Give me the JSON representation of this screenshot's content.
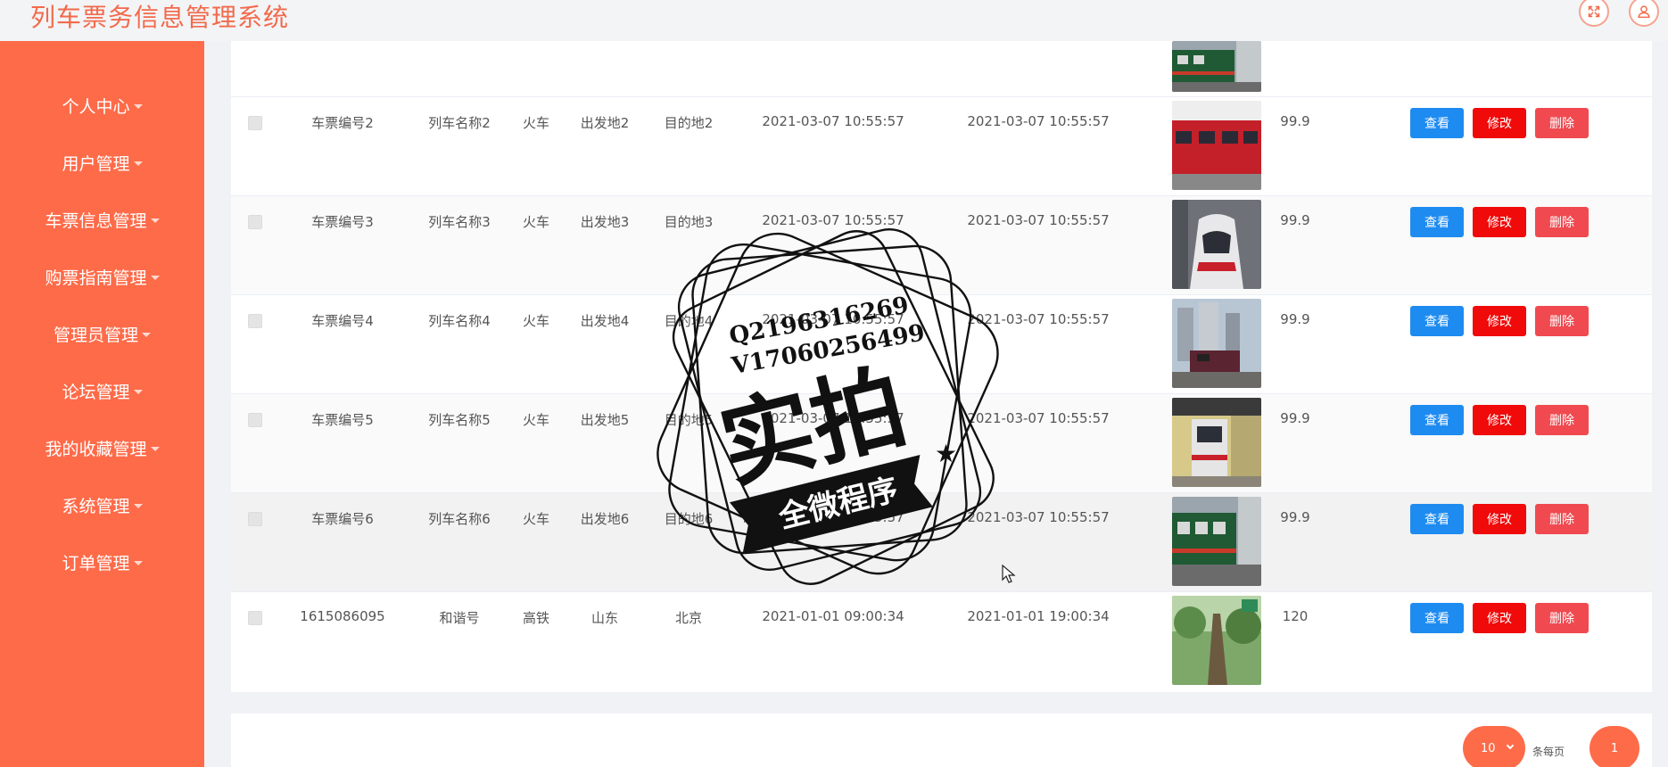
{
  "app": {
    "title": "列车票务信息管理系统"
  },
  "header": {
    "fullscreen_icon": "fullscreen-icon",
    "user_icon": "user-icon"
  },
  "sidebar": {
    "items": [
      {
        "label": "个人中心"
      },
      {
        "label": "用户管理"
      },
      {
        "label": "车票信息管理"
      },
      {
        "label": "购票指南管理"
      },
      {
        "label": "管理员管理"
      },
      {
        "label": "论坛管理"
      },
      {
        "label": "我的收藏管理"
      },
      {
        "label": "系统管理"
      },
      {
        "label": "订单管理"
      }
    ]
  },
  "table": {
    "rows": [
      {
        "ticket_no": "车票编号2",
        "train_name": "列车名称2",
        "type": "火车",
        "from": "出发地2",
        "to": "目的地2",
        "depart": "2021-03-07 10:55:57",
        "arrive": "2021-03-07 10:55:57",
        "price": "99.9",
        "image": "red-train-photo"
      },
      {
        "ticket_no": "车票编号3",
        "train_name": "列车名称3",
        "type": "火车",
        "from": "出发地3",
        "to": "目的地3",
        "depart": "2021-03-07 10:55:57",
        "arrive": "2021-03-07 10:55:57",
        "price": "99.9",
        "image": "subway-train-photo"
      },
      {
        "ticket_no": "车票编号4",
        "train_name": "列车名称4",
        "type": "火车",
        "from": "出发地4",
        "to": "目的地4",
        "depart": "2021-03-07 10:55:57",
        "arrive": "2021-03-07 10:55:57",
        "price": "99.9",
        "image": "city-train-photo"
      },
      {
        "ticket_no": "车票编号5",
        "train_name": "列车名称5",
        "type": "火车",
        "from": "出发地5",
        "to": "目的地5",
        "depart": "2021-03-07 10:55:57",
        "arrive": "2021-03-07 10:55:57",
        "price": "99.9",
        "image": "station-train-photo"
      },
      {
        "ticket_no": "车票编号6",
        "train_name": "列车名称6",
        "type": "火车",
        "from": "出发地6",
        "to": "目的地6",
        "depart": "2021-03-07 10:55:57",
        "arrive": "2021-03-07 10:55:57",
        "price": "99.9",
        "image": "green-train-photo"
      },
      {
        "ticket_no": "1615086095",
        "train_name": "和谐号",
        "type": "高铁",
        "from": "山东",
        "to": "北京",
        "depart": "2021-01-01 09:00:34",
        "arrive": "2021-01-01 19:00:34",
        "price": "120",
        "image": "forest-photo"
      }
    ],
    "actions": {
      "view": "查看",
      "edit": "修改",
      "delete": "删除"
    }
  },
  "pagination": {
    "page_size": "10",
    "per_page_label": "条每页",
    "current_page": "1"
  },
  "watermark": {
    "line1": "Q2196316269",
    "line2": "V17060256499",
    "main": "实拍",
    "banner": "全微程序"
  },
  "colors": {
    "brand": "#fe6b49",
    "view": "#1e8bf0",
    "edit": "#f00a0a",
    "delete": "#f04a50"
  }
}
